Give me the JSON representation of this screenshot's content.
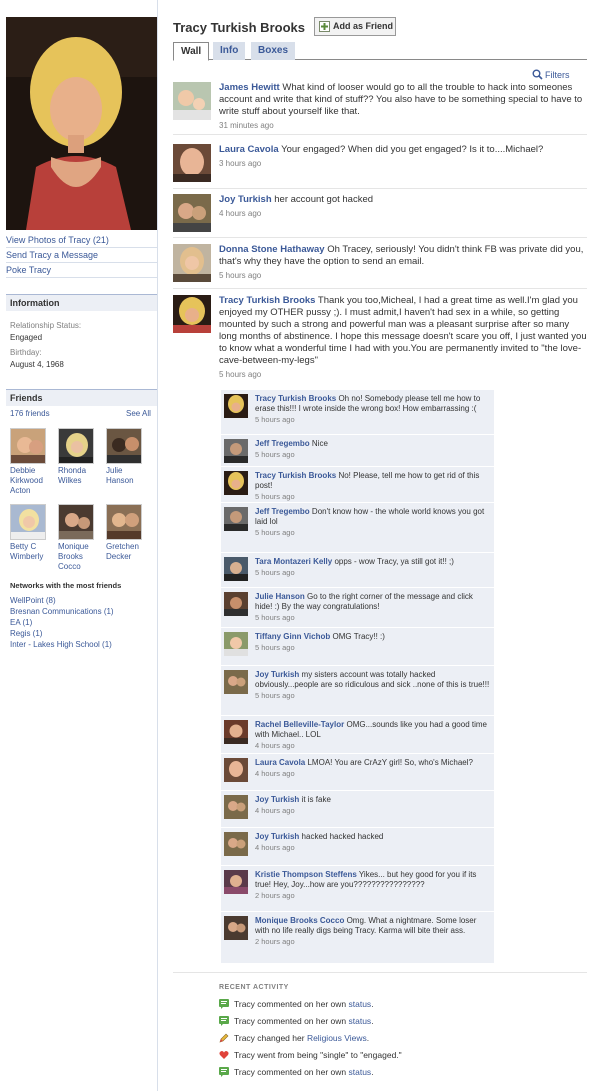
{
  "profile": {
    "name": "Tracy Turkish Brooks",
    "add_friend_label": "Add as Friend",
    "tabs": [
      "Wall",
      "Info",
      "Boxes"
    ],
    "filters_label": "Filters"
  },
  "left": {
    "actions": [
      "View Photos of Tracy (21)",
      "Send Tracy a Message",
      "Poke Tracy"
    ],
    "information": {
      "heading": "Information",
      "relationship_label": "Relationship Status:",
      "relationship_value": "Engaged",
      "birthday_label": "Birthday:",
      "birthday_value": "August 4, 1968"
    },
    "friends": {
      "heading": "Friends",
      "count": "176 friends",
      "see_all": "See All",
      "list": [
        {
          "name": "Debbie Kirkwood Acton"
        },
        {
          "name": "Rhonda Wilkes"
        },
        {
          "name": "Julie Hanson"
        },
        {
          "name": "Betty C Wimberly"
        },
        {
          "name": "Monique Brooks Cocco"
        },
        {
          "name": "Gretchen Decker"
        }
      ]
    },
    "networks": {
      "heading": "Networks with the most friends",
      "list": [
        "WellPoint (8)",
        "Bresnan Communications (1)",
        "EA (1)",
        "Regis (1)",
        "Inter - Lakes High School (1)"
      ]
    }
  },
  "wall": [
    {
      "author": "James Hewitt",
      "text": "What kind of looser would go to all the trouble to hack into someones account and write that kind of stuff?? You also have to be something special to have to write stuff about yourself like that.",
      "time": "31 minutes ago"
    },
    {
      "author": "Laura Cavola",
      "text": "Your engaged? When did you get engaged? Is it to....Michael?",
      "time": "3 hours ago"
    },
    {
      "author": "Joy Turkish",
      "text": "her account got hacked",
      "time": "4 hours ago"
    },
    {
      "author": "Donna Stone Hathaway",
      "text": "Oh Tracey, seriously! You didn't think FB was private did you, that's why they have the option to send an email.",
      "time": "5 hours ago"
    },
    {
      "author": "Tracy Turkish Brooks",
      "text": "Thank you too,Micheal, I had a great time as well.I'm glad you enjoyed my OTHER pussy ;). I must admit,I haven't had sex in a while, so getting mounted by such a strong and powerful man was a pleasant surprise after so many long months of abstinence. I hope this message doesn't scare you off, I just wanted you to know what a wonderful time I had with you.You are permanently invited to \"the love-cave-between-my-legs\"",
      "time": "5 hours ago"
    }
  ],
  "comments": [
    {
      "author": "Tracy Turkish Brooks",
      "text": "Oh no! Somebody please tell me how to erase this!!! I wrote inside the wrong box! How embarrassing :(",
      "time": "5 hours ago"
    },
    {
      "author": "Jeff Tregembo",
      "text": "Nice",
      "time": "5 hours ago"
    },
    {
      "author": "Tracy Turkish Brooks",
      "text": "No! Please, tell me how to get rid of this post!",
      "time": "5 hours ago"
    },
    {
      "author": "Jeff Tregembo",
      "text": "Don't know how - the whole world knows you got laid lol",
      "time": "5 hours ago"
    },
    {
      "author": "Tara Montazeri Kelly",
      "text": "opps - wow Tracy, ya still got it!! ;)",
      "time": "5 hours ago"
    },
    {
      "author": "Julie Hanson",
      "text": "Go to the right corner of the message and click hide! :) By the way congratulations!",
      "time": "5 hours ago"
    },
    {
      "author": "Tiffany Ginn Vichob",
      "text": "OMG Tracy!! :)",
      "time": "5 hours ago"
    },
    {
      "author": "Joy Turkish",
      "text": "my sisters account was totally hacked obviously...people are so ridiculous and sick ..none of this is true!!!",
      "time": "5 hours ago"
    },
    {
      "author": "Rachel Belleville-Taylor",
      "text": "OMG...sounds like you had a good time with Michael.. LOL",
      "time": "4 hours ago"
    },
    {
      "author": "Laura Cavola",
      "text": "LMOA! You are CrAzY girl! So, who's Michael?",
      "time": "4 hours ago"
    },
    {
      "author": "Joy Turkish",
      "text": "it is fake",
      "time": "4 hours ago"
    },
    {
      "author": "Joy Turkish",
      "text": "hacked hacked hacked",
      "time": "4 hours ago"
    },
    {
      "author": "Kristie Thompson Steffens",
      "text": "Yikes... but hey good for you if its true! Hey, Joy...how are you????????????????",
      "time": "2 hours ago"
    },
    {
      "author": "Monique Brooks Cocco",
      "text": "Omg. What a nightmare. Some loser with no life really digs being Tracy. Karma will bite their ass.",
      "time": "2 hours ago"
    }
  ],
  "recent_activity": {
    "heading": "RECENT ACTIVITY",
    "items": [
      {
        "icon": "comment-icon",
        "text": "Tracy commented on her own",
        "link": "status",
        "tail": "."
      },
      {
        "icon": "comment-icon",
        "text": "Tracy commented on her own",
        "link": "status",
        "tail": "."
      },
      {
        "icon": "pencil-icon",
        "text": "Tracy changed her",
        "link": "Religious Views",
        "tail": "."
      },
      {
        "icon": "heart-icon",
        "text": "Tracy went from being \"single\" to \"engaged.\"",
        "link": "",
        "tail": ""
      },
      {
        "icon": "comment-icon",
        "text": "Tracy commented on her own",
        "link": "status",
        "tail": "."
      }
    ]
  },
  "colors": {
    "link": "#3b5998",
    "section_bg": "#eceff5",
    "comment_bg": "#eceff5",
    "heart": "#e0433a",
    "comment_icon": "#5aa84a"
  }
}
